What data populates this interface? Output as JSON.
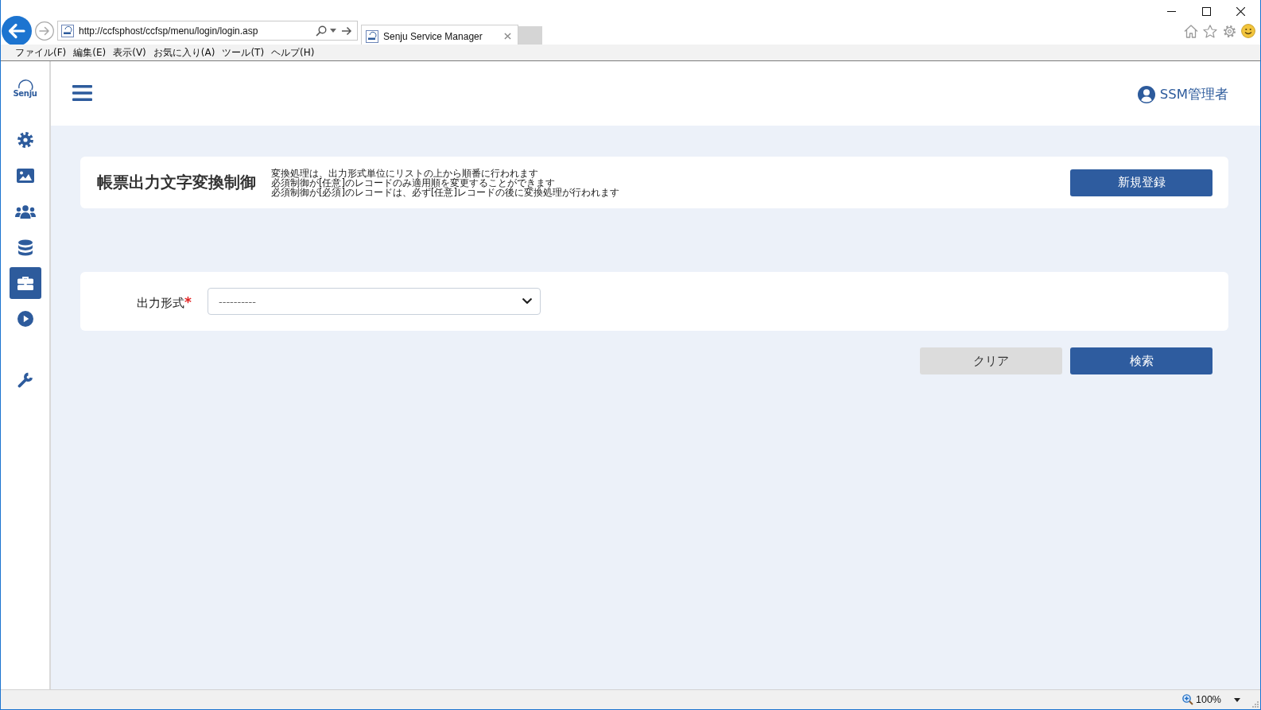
{
  "browser": {
    "address": "http://ccfsphost/ccfsp/menu/login/login.asp",
    "tabs": [
      {
        "title": "Senju Service Manager",
        "selected": true
      }
    ],
    "menu": [
      "ファイル(F)",
      "編集(E)",
      "表示(V)",
      "お気に入り(A)",
      "ツール(T)",
      "ヘルプ(H)"
    ],
    "status_bar": {
      "zoom": "100%"
    }
  },
  "sidebar": {
    "logo": "Senju",
    "groups": [
      {
        "items": [
          {
            "kind": "settings",
            "selected": false
          },
          {
            "kind": "image",
            "selected": false
          },
          {
            "kind": "users",
            "selected": false
          },
          {
            "kind": "database",
            "selected": false
          },
          {
            "kind": "briefcase",
            "selected": true
          },
          {
            "kind": "play",
            "selected": false
          }
        ]
      },
      {
        "items": [
          {
            "kind": "wrench",
            "selected": false
          }
        ]
      }
    ]
  },
  "header": {
    "user": "SSM管理者"
  },
  "page": {
    "title": "帳票出力文字変換制御",
    "notes": [
      "変換処理は、出力形式単位にリストの上から順番に行われます",
      "必須制御が[任意]のレコードのみ適用順を変更することができます",
      "必須制御が[必須]のレコードは、必ず[任意]レコードの後に変換処理が行われます"
    ],
    "new_button": "新規登録"
  },
  "form": {
    "fields": [
      {
        "label": "出力形式",
        "required_mark": "*",
        "value": "----------"
      }
    ]
  },
  "actions": [
    {
      "label": "クリア",
      "kind": "secondary"
    },
    {
      "label": "検索",
      "kind": "primary"
    }
  ]
}
